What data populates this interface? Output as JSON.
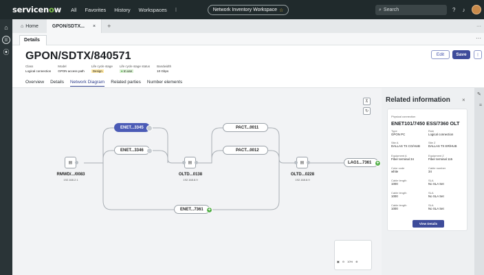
{
  "topbar": {
    "logo_pre": "servicen",
    "logo_o": "o",
    "logo_post": "w",
    "menu": [
      "All",
      "Favorites",
      "History",
      "Workspaces",
      "⁝"
    ],
    "workspace": "Network Inventory Workspace",
    "search_placeholder": "Search"
  },
  "tabs": {
    "home": "Home",
    "record": "GPON/SDTX...",
    "close": "×",
    "add": "+",
    "more": "···"
  },
  "subtab": {
    "details": "Details",
    "more": "···"
  },
  "record": {
    "title": "GPON/SDTX/840571",
    "meta": [
      {
        "label": "Class",
        "value": "Logical connection"
      },
      {
        "label": "Model",
        "value": "GPON access path"
      },
      {
        "label": "Life cycle stage",
        "value": "Design"
      },
      {
        "label": "Life cycle stage status",
        "value": "In use"
      },
      {
        "label": "Bandwidth",
        "value": "10 Gbps"
      }
    ],
    "buttons": {
      "edit": "Edit",
      "save": "Save",
      "more": "⁝"
    },
    "tabs": [
      "Overview",
      "Details",
      "Network Diagram",
      "Related parties",
      "Number elements"
    ]
  },
  "diagram": {
    "pills": {
      "enet3345": "ENET...3345",
      "enet3346": "ENET...3346",
      "pact0011": "PACT...0011",
      "pact0012": "PACT...0012",
      "lag7361": "LAG1...7361",
      "enet7361": "ENET...7361"
    },
    "devices": [
      {
        "title": "RMWD/.../0083",
        "ip": "192.168.2.1"
      },
      {
        "title": "OLTD...0138",
        "ip": "192.168.8.9"
      },
      {
        "title": "OLTD...0228",
        "ip": "192.168.8.9"
      }
    ],
    "zoom": "10%"
  },
  "panel": {
    "title": "Related information",
    "close": "×",
    "type_label": "Physical connection",
    "name": "ENET101/7450 ESS/7360 OLT",
    "fields": [
      {
        "l1": "Type",
        "v1": "GPON PC",
        "l2": "Role",
        "v2": "Logical connection"
      },
      {
        "l1": "Site A",
        "v1": "DALLAS TX CO/HUB",
        "l2": "Site Z",
        "v2": "DALLAS TX ER/HUB"
      },
      {
        "l1": "Equipment A",
        "v1": "Fiber terminal 34",
        "l2": "Equipment Z",
        "v2": "Fiber terminal 115"
      },
      {
        "l1": "Color code",
        "v1": "white",
        "l2": "Cable number",
        "v2": "34"
      },
      {
        "l1": "Cable length",
        "v1": "1000",
        "l2": "SLA",
        "v2": "No SLA Set"
      },
      {
        "l1": "Cable length",
        "v1": "1000",
        "l2": "SLA",
        "v2": "No SLA Set"
      },
      {
        "l1": "Cable length",
        "v1": "1000",
        "l2": "SLA",
        "v2": "No SLA Set"
      }
    ],
    "view_details": "View Details"
  }
}
